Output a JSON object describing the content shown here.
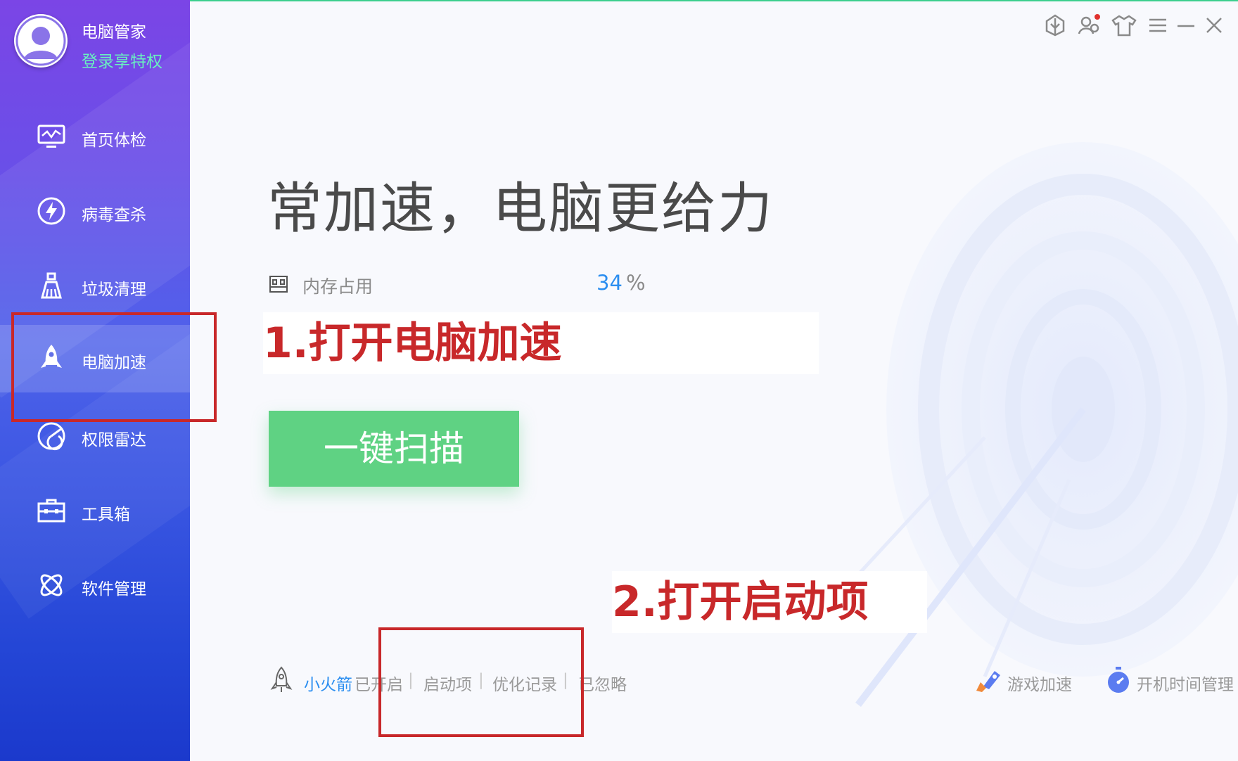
{
  "window": {
    "controls": [
      "cloud-icon",
      "user-notification-icon",
      "skin-icon",
      "menu-icon",
      "minimize-icon",
      "close-icon"
    ]
  },
  "sidebar": {
    "app_name": "电脑管家",
    "login_text": "登录享特权",
    "items": [
      {
        "label": "首页体检",
        "icon": "monitor-icon"
      },
      {
        "label": "病毒查杀",
        "icon": "lightning-shield-icon"
      },
      {
        "label": "垃圾清理",
        "icon": "broom-icon"
      },
      {
        "label": "电脑加速",
        "icon": "rocket-icon",
        "active": true
      },
      {
        "label": "权限雷达",
        "icon": "radar-icon"
      },
      {
        "label": "工具箱",
        "icon": "toolbox-icon"
      },
      {
        "label": "软件管理",
        "icon": "software-icon"
      }
    ]
  },
  "main": {
    "headline": "常加速，电脑更给力",
    "memory": {
      "label": "内存占用",
      "value": "34",
      "unit": "%"
    },
    "scan_button": "一键扫描",
    "bottom": {
      "rocket_name": "小火箭",
      "rocket_status": "已开启",
      "separator": "|",
      "startup_link": "启动项",
      "history_link": "优化记录",
      "ignored_link": "已忽略",
      "game_boost": "游戏加速",
      "boot_time": "开机时间管理"
    }
  },
  "annotations": {
    "step1": "1.打开电脑加速",
    "step2": "2.打开启动项",
    "color": "#c8282a"
  },
  "colors": {
    "accent_green": "#5fd283",
    "accent_blue": "#2b8ef0",
    "login_green": "#6af0c0"
  }
}
